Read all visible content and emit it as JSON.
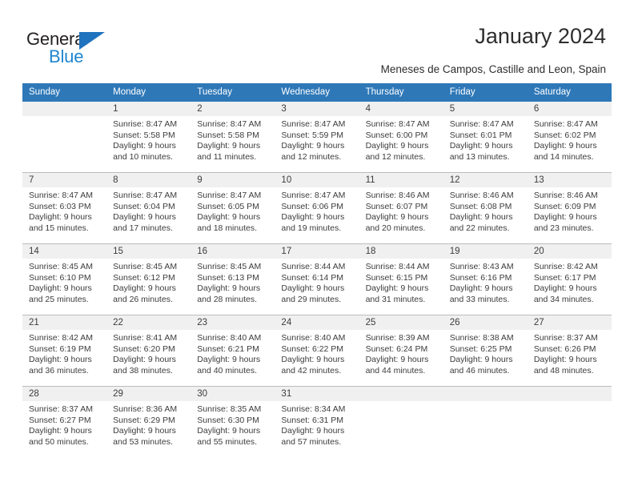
{
  "logo": {
    "word1": "General",
    "word2": "Blue",
    "triangle_color": "#1f72bd",
    "word2_color": "#1f86d0"
  },
  "header": {
    "title": "January 2024",
    "subtitle": "Meneses de Campos, Castille and Leon, Spain"
  },
  "calendar": {
    "header_bg": "#2e78b8",
    "daynum_band_bg": "#f0f0f0",
    "weekdays": [
      "Sunday",
      "Monday",
      "Tuesday",
      "Wednesday",
      "Thursday",
      "Friday",
      "Saturday"
    ],
    "weeks": [
      [
        {
          "day": "",
          "sunrise": "",
          "sunset": "",
          "daylight_line1": "",
          "daylight_line2": ""
        },
        {
          "day": "1",
          "sunrise": "Sunrise: 8:47 AM",
          "sunset": "Sunset: 5:58 PM",
          "daylight_line1": "Daylight: 9 hours",
          "daylight_line2": "and 10 minutes."
        },
        {
          "day": "2",
          "sunrise": "Sunrise: 8:47 AM",
          "sunset": "Sunset: 5:58 PM",
          "daylight_line1": "Daylight: 9 hours",
          "daylight_line2": "and 11 minutes."
        },
        {
          "day": "3",
          "sunrise": "Sunrise: 8:47 AM",
          "sunset": "Sunset: 5:59 PM",
          "daylight_line1": "Daylight: 9 hours",
          "daylight_line2": "and 12 minutes."
        },
        {
          "day": "4",
          "sunrise": "Sunrise: 8:47 AM",
          "sunset": "Sunset: 6:00 PM",
          "daylight_line1": "Daylight: 9 hours",
          "daylight_line2": "and 12 minutes."
        },
        {
          "day": "5",
          "sunrise": "Sunrise: 8:47 AM",
          "sunset": "Sunset: 6:01 PM",
          "daylight_line1": "Daylight: 9 hours",
          "daylight_line2": "and 13 minutes."
        },
        {
          "day": "6",
          "sunrise": "Sunrise: 8:47 AM",
          "sunset": "Sunset: 6:02 PM",
          "daylight_line1": "Daylight: 9 hours",
          "daylight_line2": "and 14 minutes."
        }
      ],
      [
        {
          "day": "7",
          "sunrise": "Sunrise: 8:47 AM",
          "sunset": "Sunset: 6:03 PM",
          "daylight_line1": "Daylight: 9 hours",
          "daylight_line2": "and 15 minutes."
        },
        {
          "day": "8",
          "sunrise": "Sunrise: 8:47 AM",
          "sunset": "Sunset: 6:04 PM",
          "daylight_line1": "Daylight: 9 hours",
          "daylight_line2": "and 17 minutes."
        },
        {
          "day": "9",
          "sunrise": "Sunrise: 8:47 AM",
          "sunset": "Sunset: 6:05 PM",
          "daylight_line1": "Daylight: 9 hours",
          "daylight_line2": "and 18 minutes."
        },
        {
          "day": "10",
          "sunrise": "Sunrise: 8:47 AM",
          "sunset": "Sunset: 6:06 PM",
          "daylight_line1": "Daylight: 9 hours",
          "daylight_line2": "and 19 minutes."
        },
        {
          "day": "11",
          "sunrise": "Sunrise: 8:46 AM",
          "sunset": "Sunset: 6:07 PM",
          "daylight_line1": "Daylight: 9 hours",
          "daylight_line2": "and 20 minutes."
        },
        {
          "day": "12",
          "sunrise": "Sunrise: 8:46 AM",
          "sunset": "Sunset: 6:08 PM",
          "daylight_line1": "Daylight: 9 hours",
          "daylight_line2": "and 22 minutes."
        },
        {
          "day": "13",
          "sunrise": "Sunrise: 8:46 AM",
          "sunset": "Sunset: 6:09 PM",
          "daylight_line1": "Daylight: 9 hours",
          "daylight_line2": "and 23 minutes."
        }
      ],
      [
        {
          "day": "14",
          "sunrise": "Sunrise: 8:45 AM",
          "sunset": "Sunset: 6:10 PM",
          "daylight_line1": "Daylight: 9 hours",
          "daylight_line2": "and 25 minutes."
        },
        {
          "day": "15",
          "sunrise": "Sunrise: 8:45 AM",
          "sunset": "Sunset: 6:12 PM",
          "daylight_line1": "Daylight: 9 hours",
          "daylight_line2": "and 26 minutes."
        },
        {
          "day": "16",
          "sunrise": "Sunrise: 8:45 AM",
          "sunset": "Sunset: 6:13 PM",
          "daylight_line1": "Daylight: 9 hours",
          "daylight_line2": "and 28 minutes."
        },
        {
          "day": "17",
          "sunrise": "Sunrise: 8:44 AM",
          "sunset": "Sunset: 6:14 PM",
          "daylight_line1": "Daylight: 9 hours",
          "daylight_line2": "and 29 minutes."
        },
        {
          "day": "18",
          "sunrise": "Sunrise: 8:44 AM",
          "sunset": "Sunset: 6:15 PM",
          "daylight_line1": "Daylight: 9 hours",
          "daylight_line2": "and 31 minutes."
        },
        {
          "day": "19",
          "sunrise": "Sunrise: 8:43 AM",
          "sunset": "Sunset: 6:16 PM",
          "daylight_line1": "Daylight: 9 hours",
          "daylight_line2": "and 33 minutes."
        },
        {
          "day": "20",
          "sunrise": "Sunrise: 8:42 AM",
          "sunset": "Sunset: 6:17 PM",
          "daylight_line1": "Daylight: 9 hours",
          "daylight_line2": "and 34 minutes."
        }
      ],
      [
        {
          "day": "21",
          "sunrise": "Sunrise: 8:42 AM",
          "sunset": "Sunset: 6:19 PM",
          "daylight_line1": "Daylight: 9 hours",
          "daylight_line2": "and 36 minutes."
        },
        {
          "day": "22",
          "sunrise": "Sunrise: 8:41 AM",
          "sunset": "Sunset: 6:20 PM",
          "daylight_line1": "Daylight: 9 hours",
          "daylight_line2": "and 38 minutes."
        },
        {
          "day": "23",
          "sunrise": "Sunrise: 8:40 AM",
          "sunset": "Sunset: 6:21 PM",
          "daylight_line1": "Daylight: 9 hours",
          "daylight_line2": "and 40 minutes."
        },
        {
          "day": "24",
          "sunrise": "Sunrise: 8:40 AM",
          "sunset": "Sunset: 6:22 PM",
          "daylight_line1": "Daylight: 9 hours",
          "daylight_line2": "and 42 minutes."
        },
        {
          "day": "25",
          "sunrise": "Sunrise: 8:39 AM",
          "sunset": "Sunset: 6:24 PM",
          "daylight_line1": "Daylight: 9 hours",
          "daylight_line2": "and 44 minutes."
        },
        {
          "day": "26",
          "sunrise": "Sunrise: 8:38 AM",
          "sunset": "Sunset: 6:25 PM",
          "daylight_line1": "Daylight: 9 hours",
          "daylight_line2": "and 46 minutes."
        },
        {
          "day": "27",
          "sunrise": "Sunrise: 8:37 AM",
          "sunset": "Sunset: 6:26 PM",
          "daylight_line1": "Daylight: 9 hours",
          "daylight_line2": "and 48 minutes."
        }
      ],
      [
        {
          "day": "28",
          "sunrise": "Sunrise: 8:37 AM",
          "sunset": "Sunset: 6:27 PM",
          "daylight_line1": "Daylight: 9 hours",
          "daylight_line2": "and 50 minutes."
        },
        {
          "day": "29",
          "sunrise": "Sunrise: 8:36 AM",
          "sunset": "Sunset: 6:29 PM",
          "daylight_line1": "Daylight: 9 hours",
          "daylight_line2": "and 53 minutes."
        },
        {
          "day": "30",
          "sunrise": "Sunrise: 8:35 AM",
          "sunset": "Sunset: 6:30 PM",
          "daylight_line1": "Daylight: 9 hours",
          "daylight_line2": "and 55 minutes."
        },
        {
          "day": "31",
          "sunrise": "Sunrise: 8:34 AM",
          "sunset": "Sunset: 6:31 PM",
          "daylight_line1": "Daylight: 9 hours",
          "daylight_line2": "and 57 minutes."
        },
        {
          "day": "",
          "sunrise": "",
          "sunset": "",
          "daylight_line1": "",
          "daylight_line2": ""
        },
        {
          "day": "",
          "sunrise": "",
          "sunset": "",
          "daylight_line1": "",
          "daylight_line2": ""
        },
        {
          "day": "",
          "sunrise": "",
          "sunset": "",
          "daylight_line1": "",
          "daylight_line2": ""
        }
      ]
    ]
  }
}
